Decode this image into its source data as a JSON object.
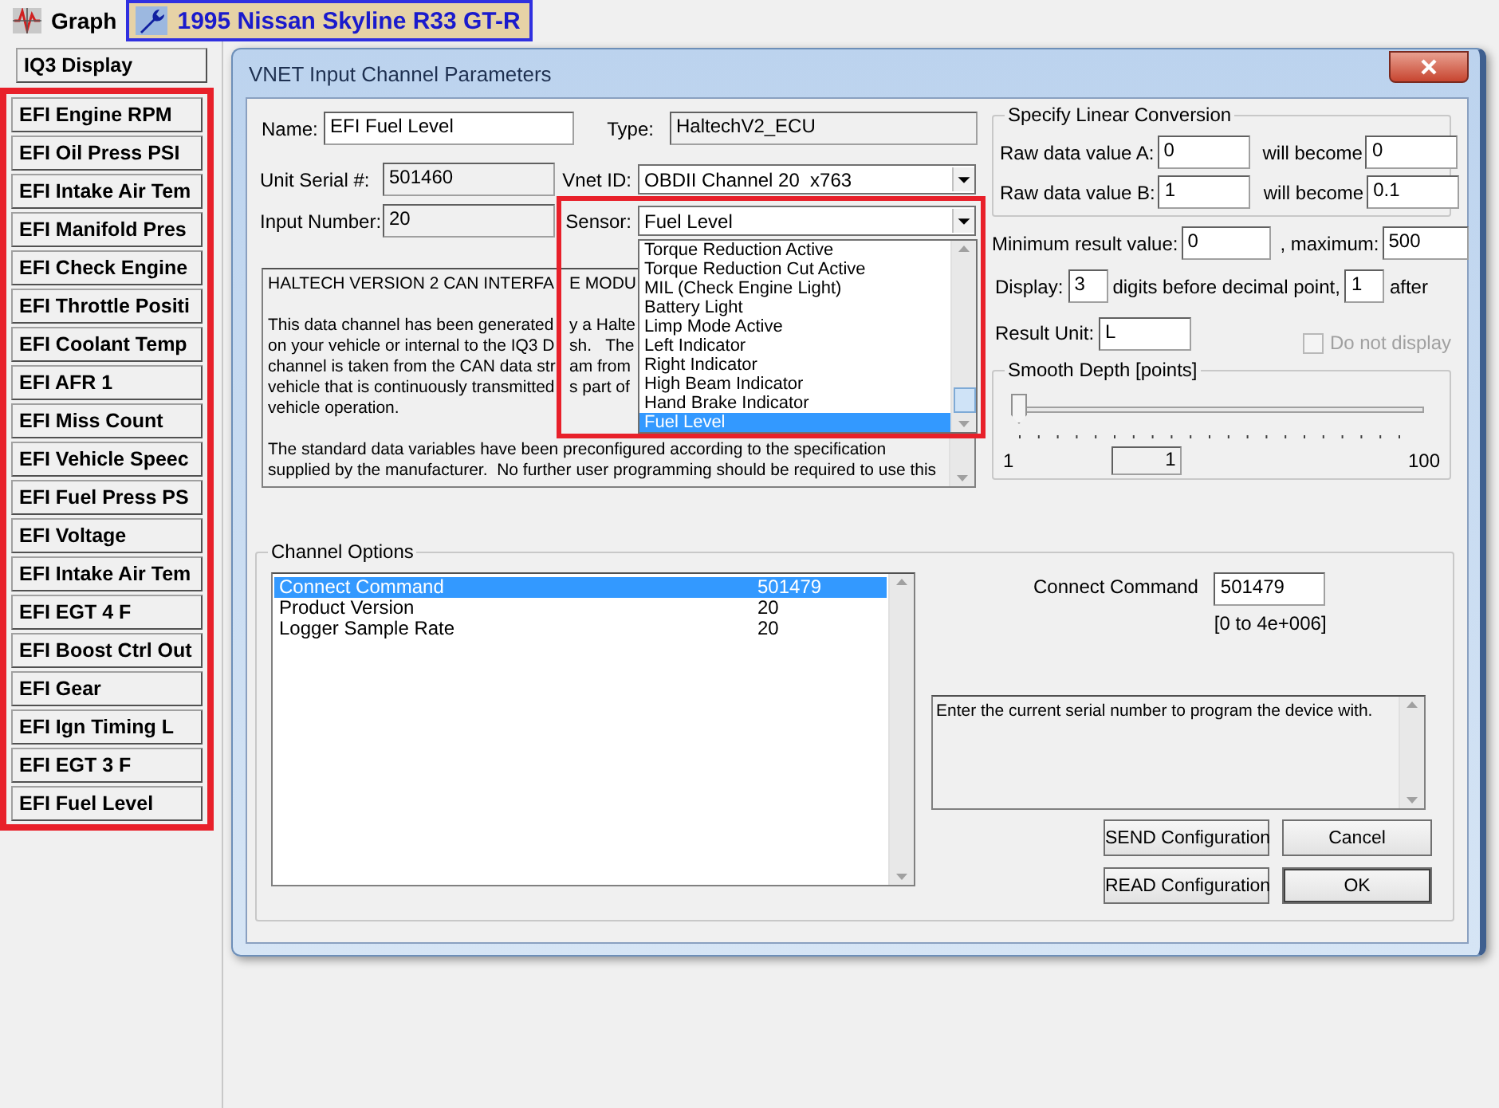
{
  "top_tabs": [
    {
      "label": "Graph",
      "kind": "graph",
      "selected": false
    },
    {
      "label": "1995 Nissan Skyline R33 GT-R",
      "kind": "vehicle",
      "selected": true
    }
  ],
  "sidebar": {
    "title_button": "IQ3 Display",
    "channels_highlighted": true,
    "channels": [
      {
        "label": "EFI Engine RPM"
      },
      {
        "label": "EFI Oil Press PSI"
      },
      {
        "label": "EFI Intake Air Tem"
      },
      {
        "label": "EFI Manifold Pres"
      },
      {
        "label": "EFI Check Engine"
      },
      {
        "label": "EFI Throttle Positi"
      },
      {
        "label": "EFI Coolant Temp"
      },
      {
        "label": "EFI AFR 1"
      },
      {
        "label": "EFI Miss Count"
      },
      {
        "label": "EFI Vehicle Speec"
      },
      {
        "label": "EFI Fuel Press PS"
      },
      {
        "label": "EFI Voltage"
      },
      {
        "label": "EFI Intake Air Tem"
      },
      {
        "label": "EFI EGT 4 F"
      },
      {
        "label": "EFI Boost Ctrl Out"
      },
      {
        "label": "EFI Gear"
      },
      {
        "label": "EFI Ign Timing L"
      },
      {
        "label": "EFI EGT 3 F"
      },
      {
        "label": "EFI Fuel Level"
      }
    ]
  },
  "dialog": {
    "title": "VNET Input Channel Parameters",
    "name": {
      "label": "Name:",
      "value": "EFI Fuel Level"
    },
    "type": {
      "label": "Type:",
      "value": "HaltechV2_ECU"
    },
    "unit_serial": {
      "label": "Unit Serial #:",
      "value": "501460"
    },
    "vnet_id": {
      "label": "Vnet ID:",
      "value": "OBDII Channel 20  x763"
    },
    "input_number": {
      "label": "Input Number:",
      "value": "20"
    },
    "sensor": {
      "label": "Sensor:",
      "value": "Fuel Level",
      "expanded": true,
      "highlighted": true,
      "options": [
        {
          "label": "Torque Reduction Active",
          "selected": false
        },
        {
          "label": "Torque Reduction Cut Active",
          "selected": false
        },
        {
          "label": "MIL (Check Engine Light)",
          "selected": false
        },
        {
          "label": "Battery Light",
          "selected": false
        },
        {
          "label": "Limp Mode Active",
          "selected": false
        },
        {
          "label": "Left Indicator",
          "selected": false
        },
        {
          "label": "Right Indicator",
          "selected": false
        },
        {
          "label": "High Beam Indicator",
          "selected": false
        },
        {
          "label": "Hand Brake Indicator",
          "selected": false
        },
        {
          "label": "Fuel Level",
          "selected": true
        }
      ]
    },
    "description": [
      {
        "lines": [
          [
            "HALTECH VERSION 2 CAN INTERFA",
            "E MODU"
          ]
        ]
      },
      {
        "lines": [
          [
            "This data channel has been generated",
            "y a Halte"
          ],
          [
            "on your vehicle or internal to the IQ3 D",
            "sh.   The"
          ],
          [
            "channel is taken from the CAN data str",
            "am from"
          ],
          [
            "vehicle that is continuously transmitted",
            "s part of"
          ],
          [
            "vehicle operation."
          ]
        ]
      },
      {
        "lines": [
          [
            "The standard data variables have been preconfigured according to the specification"
          ],
          [
            "supplied by the manufacturer.  No further user programming should be required to use this"
          ]
        ]
      }
    ],
    "linear_conversion": {
      "title": "Specify Linear Conversion",
      "rows": [
        {
          "label": "Raw data value A:",
          "raw": "0",
          "becomes_label": "will become",
          "result": "0"
        },
        {
          "label": "Raw data value B:",
          "raw": "1",
          "becomes_label": "will become",
          "result": "0.1"
        }
      ]
    },
    "minimum": {
      "label": "Minimum result value:",
      "value": "0"
    },
    "maximum": {
      "label": ", maximum:",
      "value": "500"
    },
    "display": {
      "label": "Display:",
      "before": "3",
      "middle": "digits before decimal point,",
      "after": "1",
      "suffix": "after"
    },
    "result_unit": {
      "label": "Result Unit:",
      "value": "L"
    },
    "do_not_display": {
      "label": "Do not display",
      "checked": false,
      "disabled": true
    },
    "smooth_depth": {
      "title": "Smooth Depth [points]",
      "level": 0,
      "min_label": "1",
      "value": "1",
      "max_label": "100"
    },
    "channel_options": {
      "title": "Channel Options",
      "rows": [
        {
          "name": "Connect Command",
          "value": "501479",
          "selected": true
        },
        {
          "name": "Product Version",
          "value": "20",
          "selected": false
        },
        {
          "name": "Logger Sample Rate",
          "value": "20",
          "selected": false
        }
      ],
      "editor_label": "Connect Command",
      "editor_value": "501479",
      "range": "[0 to 4e+006]",
      "help": "Enter the current serial number to program the device with."
    },
    "buttons": [
      "SEND Configuration",
      "Cancel",
      "READ Configuration",
      "OK"
    ]
  }
}
